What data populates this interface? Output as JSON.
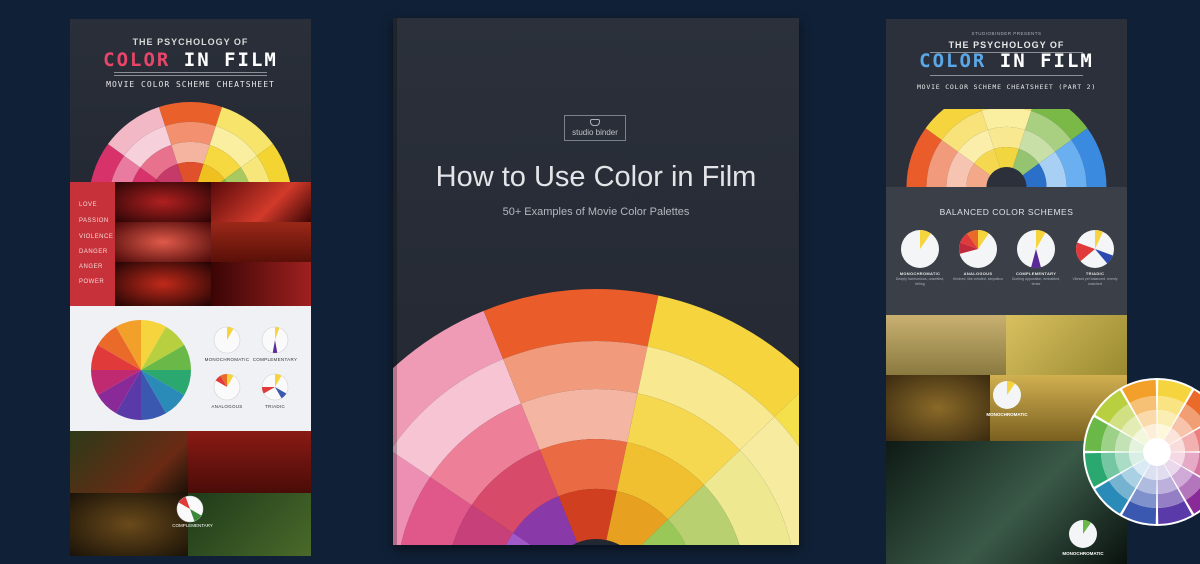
{
  "left_infographic": {
    "pretitle": "THE PSYCHOLOGY OF",
    "title_accent": "COLOR",
    "title_rest": "IN FILM",
    "subtitle": "MOVIE COLOR SCHEME CHEATSHEET",
    "accent_color": "#e8456a",
    "emotion_words": [
      "LOVE",
      "PASSION",
      "VIOLENCE",
      "DANGER",
      "ANGER",
      "POWER"
    ],
    "schemes": [
      {
        "label": "MONOCHROMATIC"
      },
      {
        "label": "COMPLEMENTARY"
      },
      {
        "label": "ANALOGOUS"
      },
      {
        "label": "TRIADIC"
      }
    ],
    "complementary_label": "COMPLEMENTARY"
  },
  "book": {
    "brand": "studio binder",
    "title": "How to Use Color in Film",
    "subtitle": "50+ Examples of Movie Color Palettes"
  },
  "right_infographic": {
    "pretitle": "STUDIOBINDER PRESENTS",
    "pretitle2": "THE PSYCHOLOGY OF",
    "title_accent": "COLOR",
    "title_rest": "IN FILM",
    "subtitle": "MOVIE COLOR SCHEME CHEATSHEET (PART 2)",
    "accent_color": "#5aa8e8",
    "balanced_title": "BALANCED COLOR SCHEMES",
    "schemes": [
      {
        "name": "MONOCHROMATIC",
        "desc": "Deeply harmonious, unsettled, telling"
      },
      {
        "name": "ANALOGOUS",
        "desc": "Kindred, like-minded, simpatico"
      },
      {
        "name": "COMPLEMENTARY",
        "desc": "Dueling opposition, embattled, tense"
      },
      {
        "name": "TRIADIC",
        "desc": "Vibrant yet balanced, evenly matched"
      }
    ],
    "mono_label_1": "MONOCHROMATIC",
    "mono_label_2": "MONOCHROMATIC"
  }
}
